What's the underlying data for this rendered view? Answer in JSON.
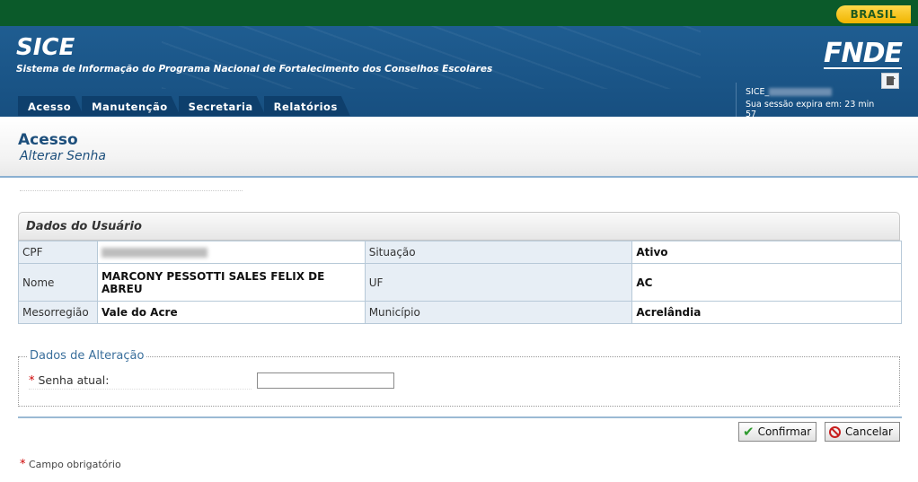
{
  "gov_bar": {
    "brasil": "BRASIL"
  },
  "header": {
    "app_name": "SICE",
    "app_subtitle": "Sistema de Informação do Programa Nacional de Fortalecimento dos Conselhos Escolares",
    "org_logo": "FNDE",
    "nav": [
      "Acesso",
      "Manutenção",
      "Secretaria",
      "Relatórios"
    ],
    "session_user_prefix": "SICE_",
    "session_expiry": "Sua sessão expira em: 23 min 57"
  },
  "page": {
    "title": "Acesso",
    "subtitle": "Alterar Senha"
  },
  "user_panel": {
    "heading": "Dados do Usuário",
    "rows": [
      {
        "label1": "CPF",
        "value1": "",
        "label2": "Situação",
        "value2": "Ativo"
      },
      {
        "label1": "Nome",
        "value1": "MARCONY PESSOTTI SALES FELIX DE ABREU",
        "label2": "UF",
        "value2": "AC"
      },
      {
        "label1": "Mesorregião",
        "value1": "Vale do Acre",
        "label2": "Município",
        "value2": "Acrelândia"
      }
    ]
  },
  "change_panel": {
    "legend": "Dados de Alteração",
    "required_marker": "*",
    "field_label": "Senha atual:",
    "field_value": ""
  },
  "buttons": {
    "confirm": "Confirmar",
    "cancel": "Cancelar"
  },
  "footnote": {
    "marker": "*",
    "text": "Campo obrigatório"
  },
  "icons": {
    "confirm": "check-icon",
    "cancel": "cancel-icon",
    "logout": "logout-icon"
  }
}
